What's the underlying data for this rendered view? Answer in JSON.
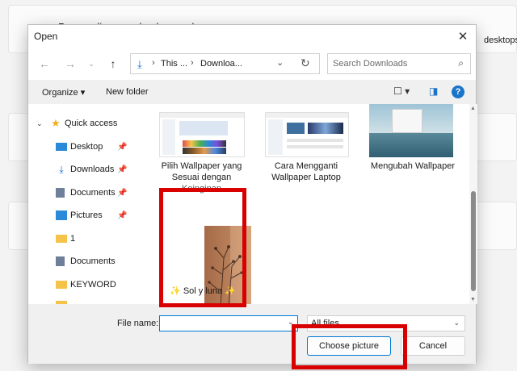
{
  "background": {
    "title": "Personalize your background",
    "desc_tail": "desktops."
  },
  "dialog": {
    "title": "Open",
    "address": {
      "segments": [
        "This ...",
        "Downloa..."
      ]
    },
    "search": {
      "placeholder": "Search Downloads"
    },
    "toolbar": {
      "organize": "Organize",
      "new_folder": "New folder"
    },
    "sidebar": [
      {
        "label": "Quick access",
        "icon": "star-icon"
      },
      {
        "label": "Desktop",
        "icon": "desktop-icon",
        "pinned": true
      },
      {
        "label": "Downloads",
        "icon": "download-icon",
        "pinned": true
      },
      {
        "label": "Documents",
        "icon": "documents-icon",
        "pinned": true
      },
      {
        "label": "Pictures",
        "icon": "pictures-icon",
        "pinned": true
      },
      {
        "label": "1",
        "icon": "folder-icon"
      },
      {
        "label": "Documents",
        "icon": "documents-icon"
      },
      {
        "label": "KEYWORD",
        "icon": "folder-icon"
      }
    ],
    "files": [
      {
        "label_lines": [
          "Pilih Wallpaper yang",
          "Sesuai dengan",
          "Keinginan"
        ]
      },
      {
        "label_lines": [
          "Cara Mengganti",
          "Wallpaper Laptop"
        ]
      },
      {
        "label_lines": [
          "Mengubah Wallpaper"
        ]
      },
      {
        "label_lines": [
          "✨ Sol y luna ✨"
        ]
      }
    ],
    "bottom": {
      "file_name_label": "File name:",
      "file_name_value": "",
      "filter": "All files",
      "choose_btn": "Choose picture",
      "cancel_btn": "Cancel"
    }
  },
  "colors": {
    "accent": "#0078d4",
    "highlight": "#d90000"
  }
}
